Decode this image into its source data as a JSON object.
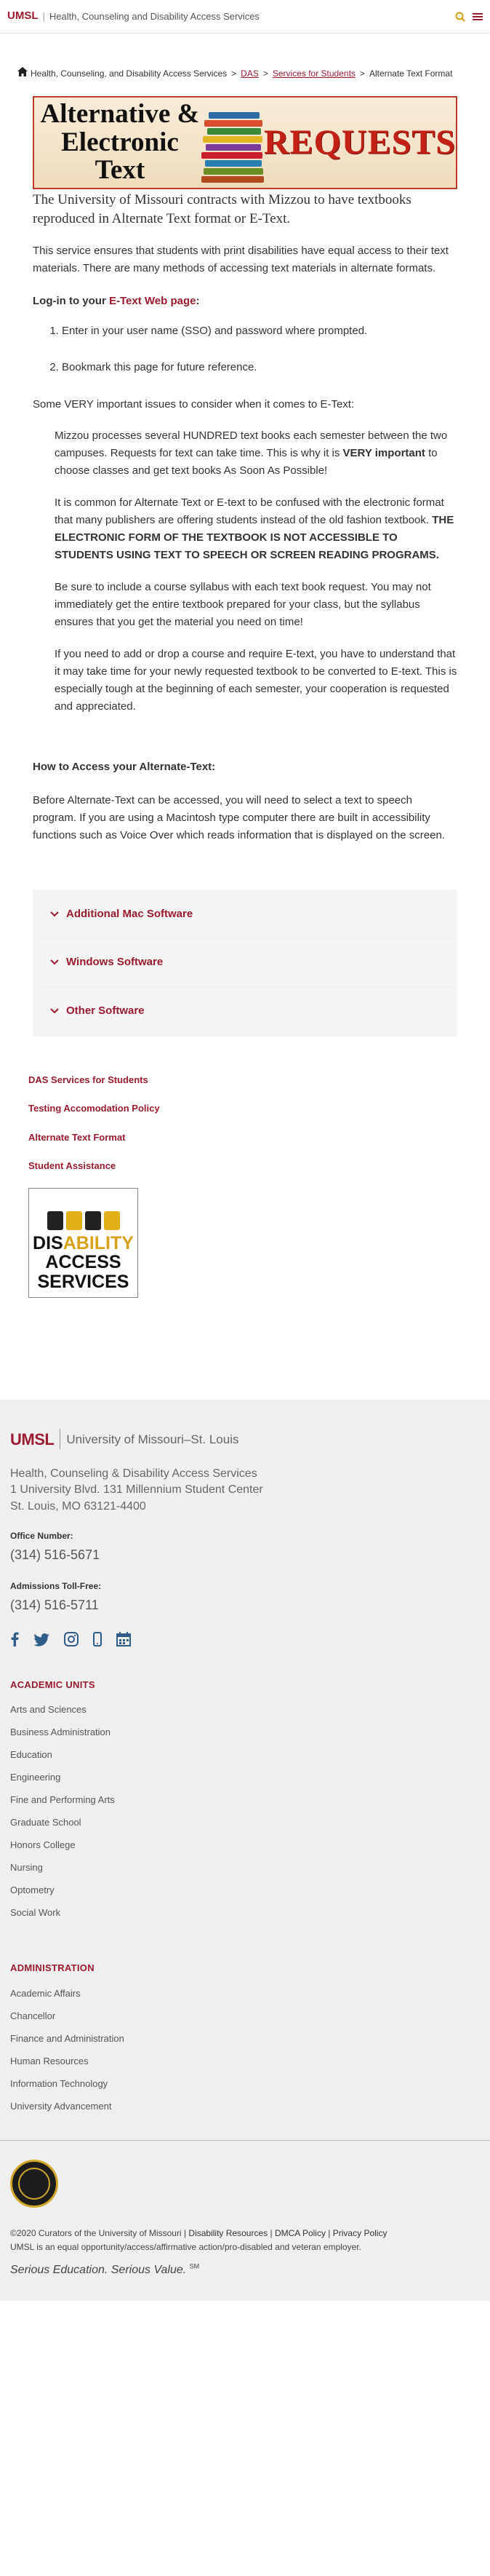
{
  "topbar": {
    "brand": "UMSL",
    "separator": "|",
    "site_name": "Health, Counseling and Disability Access Services"
  },
  "breadcrumb": {
    "home": "Health, Counseling, and Disability Access Services",
    "das": "DAS",
    "services": "Services for Students",
    "current": "Alternate Text Format",
    "separator": ">"
  },
  "banner": {
    "left_line1": "Alternative &",
    "left_line2": "Electronic Text",
    "right": "REQUESTS"
  },
  "content": {
    "lead": "The University of Missouri contracts with Mizzou to have textbooks reproduced in Alternate Text format or E-Text.",
    "para1": "This service ensures that students with print disabilities have equal access to their text materials. There are many methods of accessing text materials in alternate formats.",
    "login_prefix": "Log-in to your ",
    "login_link": "E-Text Web page",
    "login_suffix": ":",
    "steps": [
      "Enter in your user name (SSO) and password where prompted.",
      "Bookmark this page for future reference."
    ],
    "issues_intro": "Some VERY important issues to consider when it comes to E-Text:",
    "issue1_text": "Mizzou processes several HUNDRED text books each semester between the two campuses. Requests for text can take time. This is why it is ",
    "issue1_bold": "VERY important",
    "issue1_tail": " to choose classes and get text books As Soon As Possible!",
    "issue2_text": "It is common for Alternate Text or E-text to be confused with the electronic format that many publishers are offering students instead of the old fashion textbook. ",
    "issue2_bold": "THE ELECTRONIC FORM OF THE TEXTBOOK IS NOT ACCESSIBLE TO STUDENTS USING TEXT TO SPEECH OR SCREEN READING PROGRAMS.",
    "issue3": "Be sure to include a course syllabus with each text book request. You may not immediately get the entire textbook prepared for your class, but the syllabus ensures that you get the material you need on time!",
    "issue4": "If you need to add or drop a course and require E-text, you have to understand that it may take time for your newly requested textbook to be converted to E-text. This is especially tough at the beginning of each semester, your cooperation is requested and appreciated.",
    "access_heading": "How to Access your Alternate-Text:",
    "access_para": "Before Alternate-Text can be accessed, you will need to select a text to speech program. If you are using a Macintosh type computer there are built in accessibility functions such as Voice Over which reads information that is displayed on the screen."
  },
  "accordion": [
    {
      "label": "Additional Mac Software"
    },
    {
      "label": "Windows Software"
    },
    {
      "label": "Other Software"
    }
  ],
  "side_links": [
    {
      "label": "DAS Services for Students"
    },
    {
      "label": "Testing Accomodation Policy"
    },
    {
      "label": "Alternate Text Format"
    },
    {
      "label": "Student Assistance"
    }
  ],
  "das_logo": {
    "line1_a": "DIS",
    "line1_b": "ABILITY",
    "line2": "ACCESS",
    "line3": "SERVICES"
  },
  "footer": {
    "brand": "UMSL",
    "university": "University of Missouri–St. Louis",
    "dept": "Health, Counseling & Disability Access Services",
    "address1": "1 University Blvd. 131 Millennium Student Center",
    "address2": "St. Louis, MO 63121-4400",
    "office_label": "Office Number:",
    "office_phone": "(314) 516-5671",
    "admissions_label": "Admissions Toll-Free:",
    "admissions_phone": "(314) 516-5711",
    "academic_heading": "ACADEMIC UNITS",
    "academic": [
      "Arts and Sciences",
      "Business Administration",
      "Education",
      "Engineering",
      "Fine and Performing Arts",
      "Graduate School",
      "Honors College",
      "Nursing",
      "Optometry",
      "Social Work"
    ],
    "admin_heading": "ADMINISTRATION",
    "admin": [
      "Academic Affairs",
      "Chancellor",
      "Finance and Administration",
      "Human Resources",
      "Information Technology",
      "University Advancement"
    ]
  },
  "legal": {
    "copyright": "©2020 Curators of the University of Missouri",
    "sep": "|",
    "disability": "Disability Resources",
    "dmca": "DMCA Policy",
    "privacy": "Privacy Policy",
    "eeo": "UMSL is an equal opportunity/access/affirmative action/pro-disabled and veteran employer.",
    "tagline": "Serious Education. Serious Value.",
    "sm": "SM"
  },
  "colors": {
    "accent": "#9b1b30",
    "banner_red": "#c32016",
    "social_blue": "#2f5d8a"
  }
}
